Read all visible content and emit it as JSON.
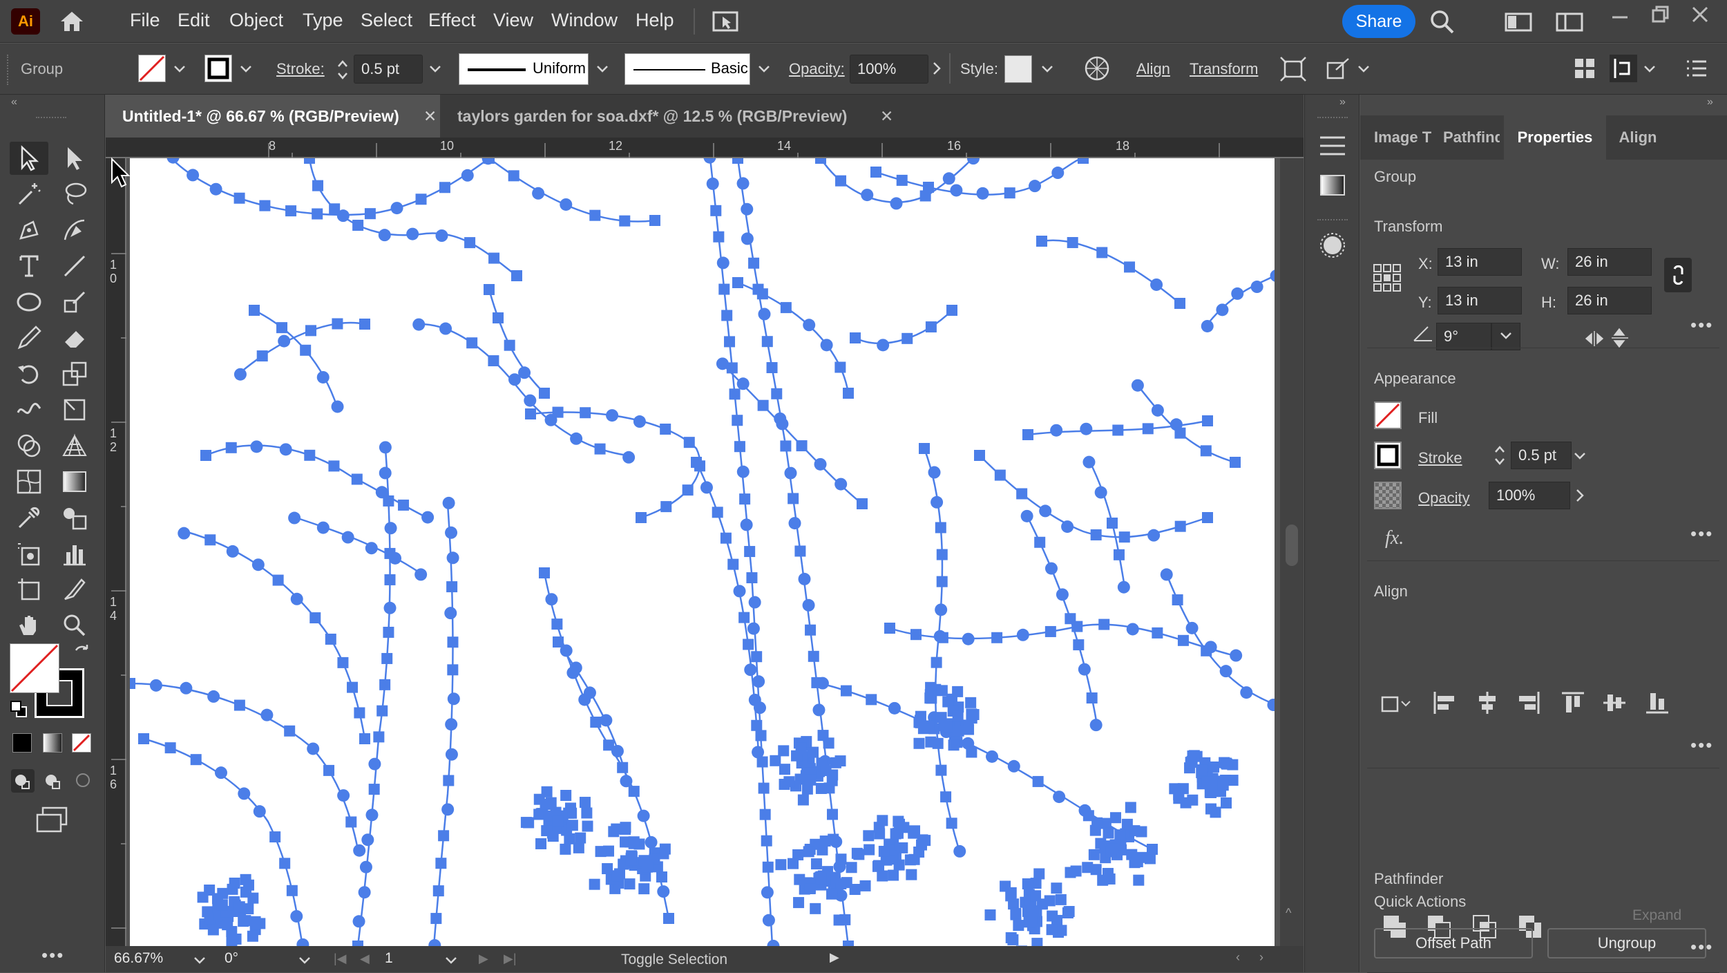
{
  "app": {
    "logo": "Ai"
  },
  "menu": [
    "File",
    "Edit",
    "Object",
    "Type",
    "Select",
    "Effect",
    "View",
    "Window",
    "Help"
  ],
  "share_label": "Share",
  "control": {
    "selection_type": "Group",
    "stroke_label": "Stroke:",
    "stroke_value": "0.5 pt",
    "profile_label": "Uniform",
    "brush_label": "Basic",
    "opacity_label": "Opacity:",
    "opacity_value": "100%",
    "style_label": "Style:",
    "align_label": "Align",
    "transform_label": "Transform"
  },
  "tabs": [
    {
      "label": "Untitled-1* @ 66.67 % (RGB/Preview)",
      "active": true
    },
    {
      "label": "taylors garden for soa.dxf* @ 12.5 % (RGB/Preview)",
      "active": false
    }
  ],
  "ruler": {
    "top": [
      "8",
      "10",
      "12",
      "14",
      "16",
      "18"
    ],
    "left": [
      "1\n0",
      "1\n2",
      "1\n4",
      "1\n6"
    ]
  },
  "status": {
    "zoom": "66.67%",
    "rotation": "0°",
    "artboard": "1",
    "info": "Toggle Selection"
  },
  "panel_tabs": [
    "Image Tı",
    "Pathfind",
    "Properties",
    "Align"
  ],
  "properties": {
    "selection": "Group",
    "transform_title": "Transform",
    "x_label": "X:",
    "x_value": "13 in",
    "y_label": "Y:",
    "y_value": "13 in",
    "w_label": "W:",
    "w_value": "26 in",
    "h_label": "H:",
    "h_value": "26 in",
    "angle_value": "9°",
    "appearance_title": "Appearance",
    "fill_label": "Fill",
    "stroke_label": "Stroke",
    "stroke_value": "0.5 pt",
    "opacity_label": "Opacity",
    "opacity_value": "100%",
    "fx_label": "fx.",
    "align_title": "Align",
    "pathfinder_title": "Pathfinder",
    "expand_label": "Expand",
    "quick_actions_title": "Quick Actions",
    "offset_path_label": "Offset Path",
    "ungroup_label": "Ungroup"
  },
  "colors": {
    "accent": "#1473e6",
    "path": "#4b7ee8",
    "artboard": "#ffffff"
  }
}
